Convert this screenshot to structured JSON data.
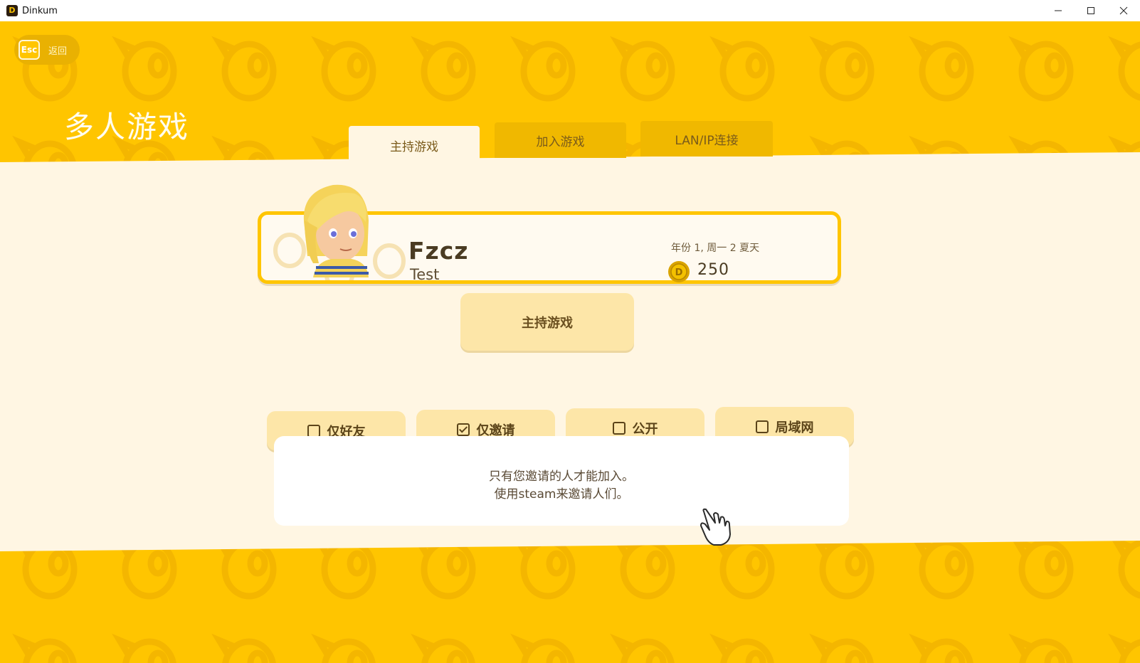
{
  "window": {
    "title": "Dinkum",
    "icon": "dinkum-app-icon",
    "controls": [
      "minimize-icon",
      "maximize-icon",
      "close-icon"
    ]
  },
  "back": {
    "key": "Esc",
    "label": "返回"
  },
  "page_title": "多人游戏",
  "tabs": [
    {
      "label": "主持游戏",
      "active": true
    },
    {
      "label": "加入游戏",
      "active": false
    },
    {
      "label": "LAN/IP连接",
      "active": false
    }
  ],
  "profile": {
    "name": "Fzcz",
    "subtitle": "Test",
    "date": "年份 1, 周一 2 夏天",
    "money": "250",
    "coin_icon": "dinks-coin-icon",
    "avatar": "player-avatar"
  },
  "host_button": "主持游戏",
  "options": [
    {
      "label": "仅好友",
      "checked": false
    },
    {
      "label": "仅邀请",
      "checked": true
    },
    {
      "label": "公开",
      "checked": false
    },
    {
      "label": "局域网",
      "checked": false
    }
  ],
  "description": {
    "line1": "只有您邀请的人才能加入。",
    "line2": "使用steam来邀请人们。"
  },
  "colors": {
    "yellow": "#ffc500",
    "cream": "#fff6e3",
    "button": "#fde6a8",
    "text_brown": "#5b4419"
  },
  "cursor": "hand-pointer-icon"
}
